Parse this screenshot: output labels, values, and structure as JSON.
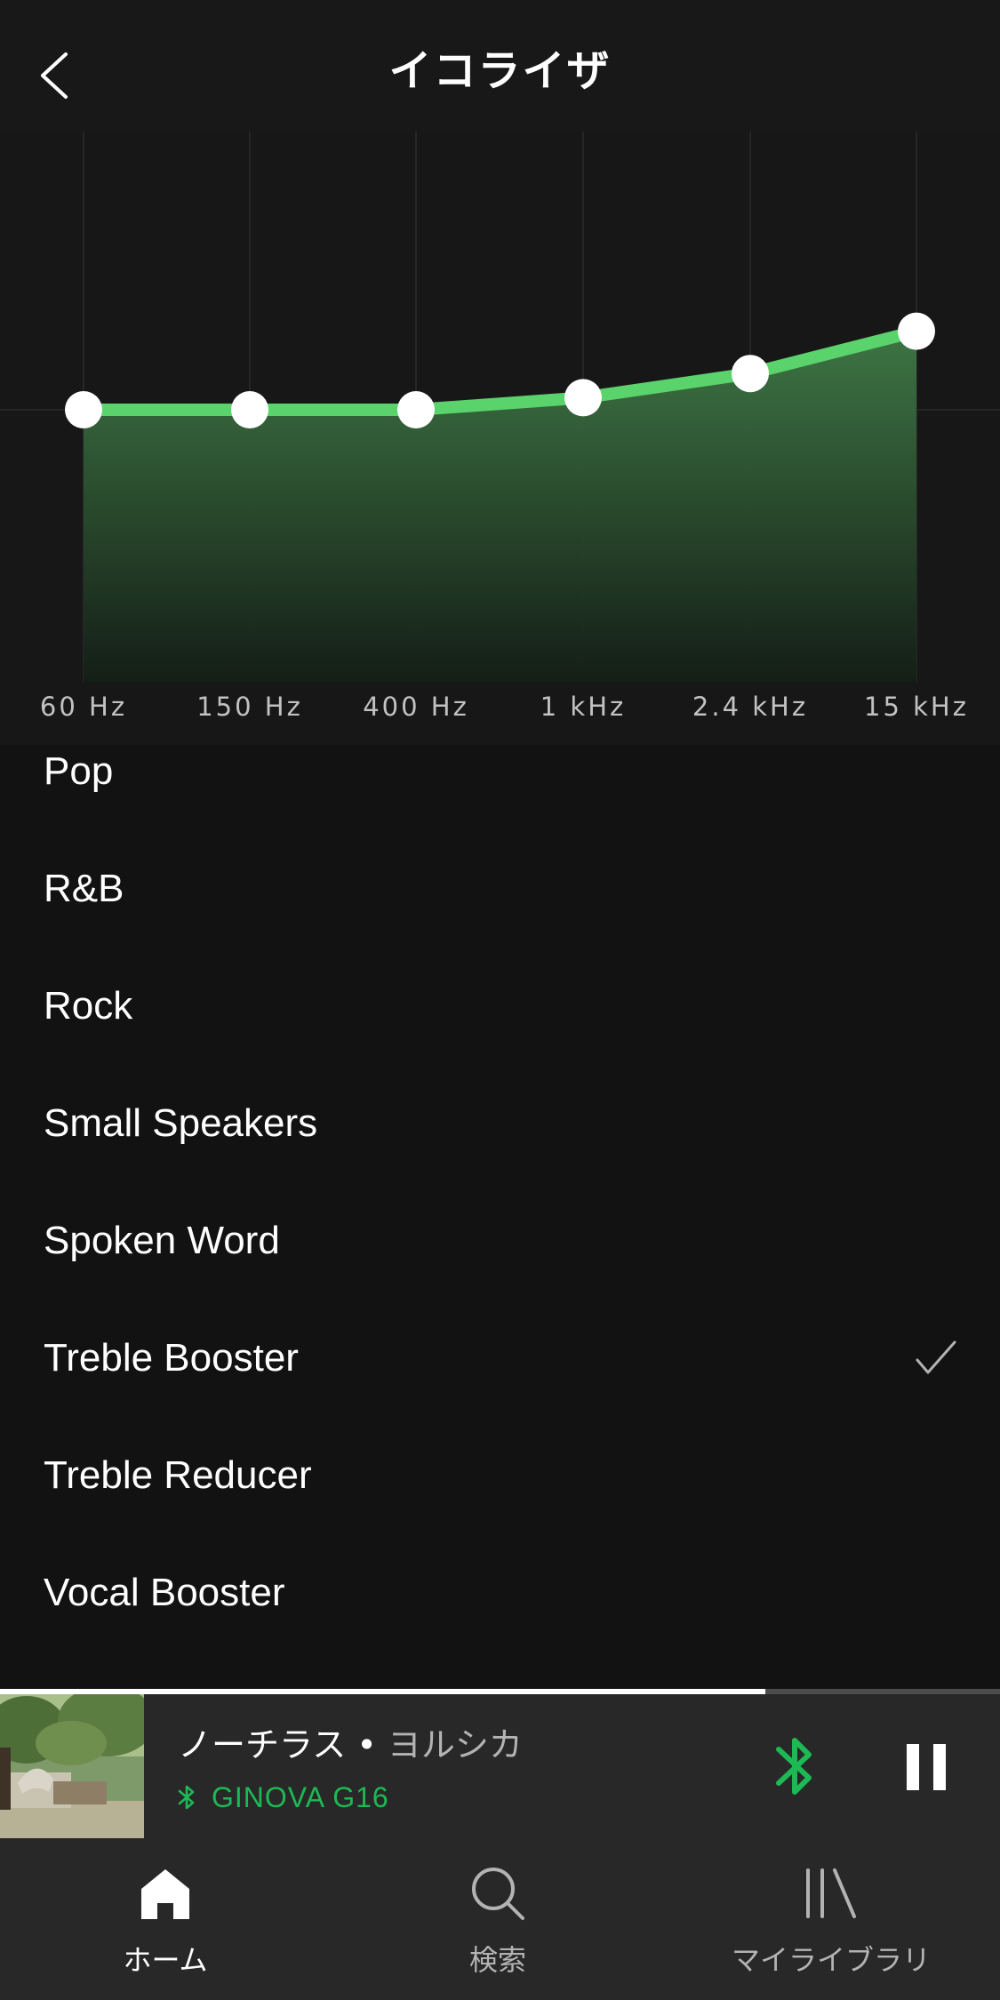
{
  "header": {
    "title": "イコライザ",
    "back_icon": "chevron-left-icon"
  },
  "equalizer": {
    "bands": [
      {
        "label": "60 Hz",
        "gain": 0
      },
      {
        "label": "150 Hz",
        "gain": 0
      },
      {
        "label": "400 Hz",
        "gain": 0
      },
      {
        "label": "1 kHz",
        "gain": 1
      },
      {
        "label": "2.4 kHz",
        "gain": 3
      },
      {
        "label": "15 kHz",
        "gain": 6.5
      }
    ],
    "gain_range": [
      -12,
      12
    ],
    "line_color": "#5ad36c"
  },
  "presets": {
    "items": [
      {
        "label": "Pop",
        "selected": false
      },
      {
        "label": "R&B",
        "selected": false
      },
      {
        "label": "Rock",
        "selected": false
      },
      {
        "label": "Small Speakers",
        "selected": false
      },
      {
        "label": "Spoken Word",
        "selected": false
      },
      {
        "label": "Treble Booster",
        "selected": true
      },
      {
        "label": "Treble Reducer",
        "selected": false
      },
      {
        "label": "Vocal Booster",
        "selected": false
      }
    ]
  },
  "now_playing": {
    "title": "ノーチラス",
    "separator": " • ",
    "artist": "ヨルシカ",
    "device": "GINOVA G16",
    "progress": 0.765,
    "accent_color": "#1db954"
  },
  "tabs": [
    {
      "label": "ホーム",
      "icon": "home-icon",
      "active": true
    },
    {
      "label": "検索",
      "icon": "search-icon",
      "active": false
    },
    {
      "label": "マイライブラリ",
      "icon": "library-icon",
      "active": false
    }
  ]
}
